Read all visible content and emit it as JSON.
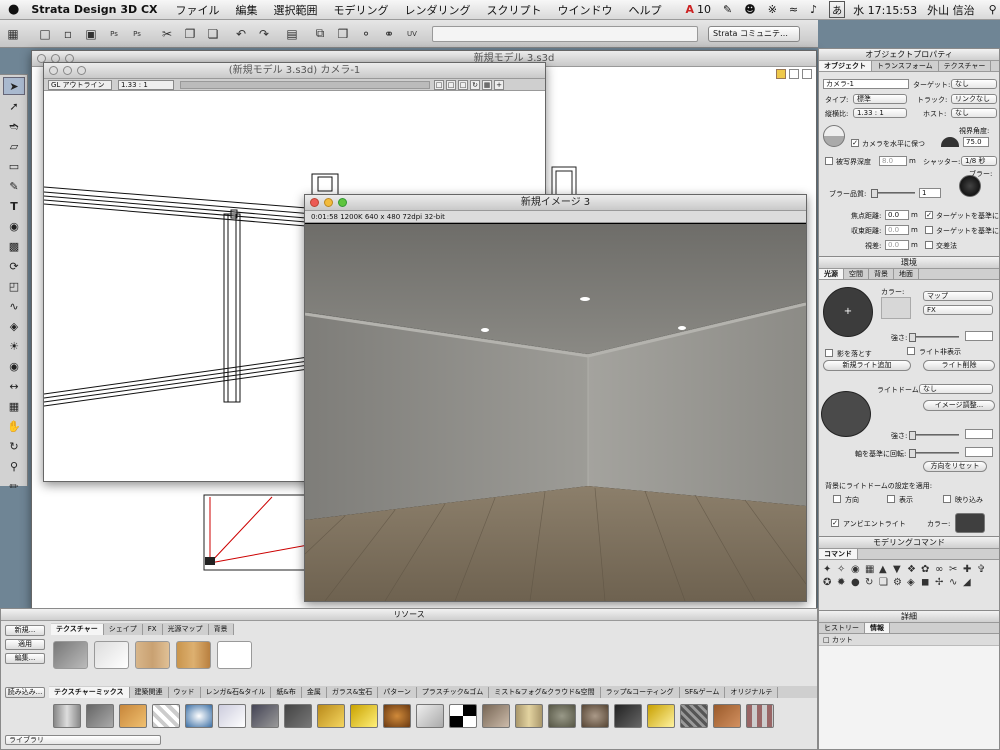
{
  "menubar": {
    "app": "Strata Design 3D CX",
    "items": [
      "ファイル",
      "編集",
      "選択範囲",
      "モデリング",
      "レンダリング",
      "スクリプト",
      "ウインドウ",
      "ヘルプ"
    ],
    "badge": "10",
    "lang": "あ",
    "clock": "水 17:15:53",
    "user": "外山 信治"
  },
  "toolbar": {
    "community": "Strata コミュニテ…"
  },
  "back_window": {
    "title": "新規モデル 3.s3d"
  },
  "camera_window": {
    "title": "(新規モデル 3.s3d) カメラ-1",
    "mode": "GL アウトライン",
    "ratio": "1.33 : 1"
  },
  "render_window": {
    "title": "新規イメージ 3",
    "status": "0:01:58   1200K   640 x 480   72dpi   32-bit"
  },
  "object_props": {
    "title": "オブジェクトプロパティ",
    "tabs": [
      "オブジェクト",
      "トランスフォーム",
      "テクスチャー"
    ],
    "name": "カメラ-1",
    "target_label": "ターゲット:",
    "target_value": "なし",
    "type_label": "タイプ:",
    "type_value": "標準",
    "track_label": "トラック:",
    "track_value": "リンクなし",
    "aspect_label": "縦横比:",
    "aspect_value": "1.33 : 1",
    "host_label": "ホスト:",
    "host_value": "なし",
    "fov_label": "視界角度:",
    "fov_value": "75.0",
    "keep_horizontal": "カメラを水平に保つ",
    "dof_label": "被写界深度",
    "dof_value": "8.0",
    "dof_unit": "m",
    "shutter_label": "シャッター:",
    "shutter_value": "1/8 秒",
    "blur_label": "ブラー:",
    "blur_quality": "ブラー品質:",
    "blur_quality_value": "1",
    "focus_label": "焦点距離:",
    "focus_value": "0.0",
    "focus_unit": "m",
    "focus_check": "ターゲットを基準に",
    "converge_label": "収束距離:",
    "converge_value": "0.0",
    "converge_unit": "m",
    "converge_check": "ターゲットを基準に",
    "parallax_label": "視差:",
    "parallax_value": "0.0",
    "parallax_unit": "m",
    "cross_check": "交差法"
  },
  "environment": {
    "title": "環境",
    "tabs": [
      "光源",
      "空間",
      "背景",
      "地面"
    ],
    "color_label": "カラー:",
    "map_value": "マップ",
    "fx_value": "FX",
    "intensity_label": "強さ:",
    "cast_shadow": "影を落とす",
    "show_light": "ライト非表示",
    "add_light": "新規ライト追加",
    "delete_light": "ライト削除",
    "dome_label": "ライトドーム:",
    "dome_value": "なし",
    "image_adjust": "イメージ調整...",
    "intensity2_label": "強さ:",
    "rotate_label": "軸を基準に回転:",
    "reset_dir": "方向をリセット",
    "apply_bg": "背景にライトドームの設定を適用:",
    "chk_dir": "方向",
    "chk_show": "表示",
    "chk_reflect": "映り込み",
    "ambient": "アンビエントライト",
    "ambient_color_label": "カラー:"
  },
  "modeling": {
    "title": "モデリングコマンド",
    "tab": "コマンド"
  },
  "details": {
    "title": "詳細",
    "tabs": [
      "ヒストリー",
      "情報"
    ],
    "item": "カット"
  },
  "resources": {
    "title": "リソース",
    "tabs": [
      "テクスチャー",
      "シェイプ",
      "FX",
      "光源マップ",
      "背景"
    ],
    "buttons": [
      "新規...",
      "適用",
      "編集...",
      "読み込み..."
    ],
    "library_tabs": [
      "テクスチャーミックス",
      "建築関連",
      "ウッド",
      "レンガ&石&タイル",
      "紙&布",
      "金属",
      "ガラス&宝石",
      "パターン",
      "プラスチック&ゴム",
      "ミスト&フォグ&クラウド&空間",
      "ラップ&コーティング",
      "SF&ゲーム",
      "オリジナルテ"
    ],
    "library_select": "ライブラリ"
  },
  "colors": {
    "desktop": "#6f8595",
    "panel": "#e4e4e4",
    "selected_tool": "#a9b9cf"
  }
}
